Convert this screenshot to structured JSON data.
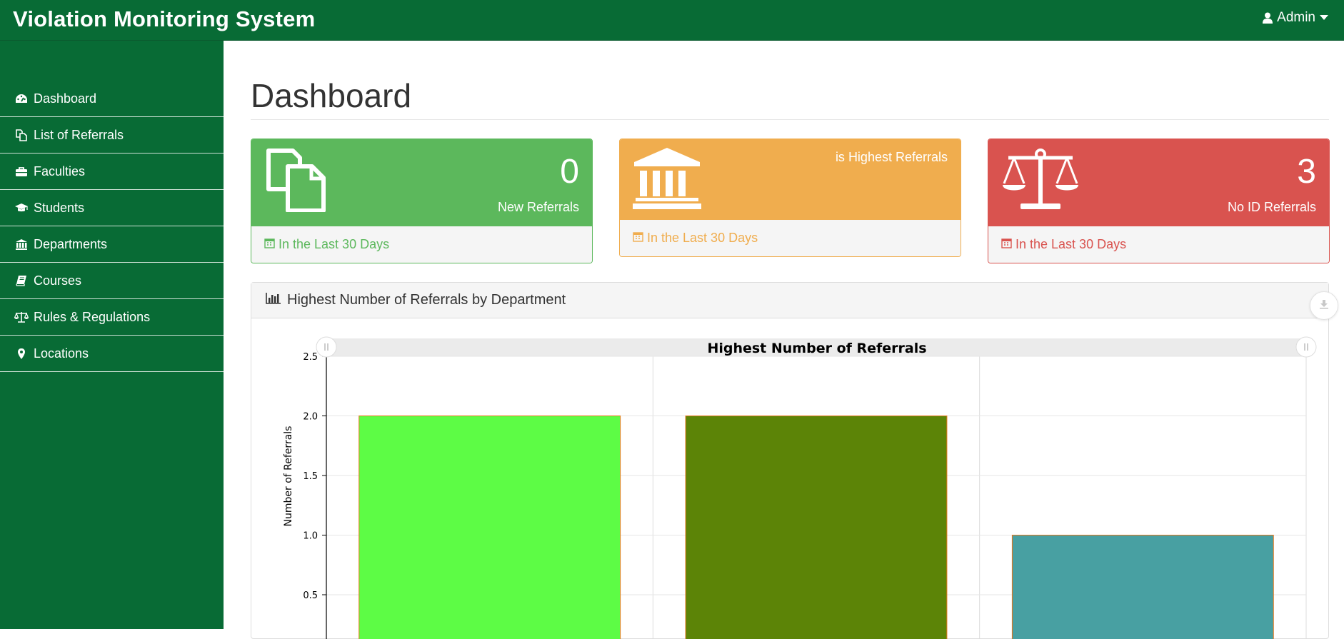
{
  "app": {
    "title": "Violation Monitoring System"
  },
  "user_menu": {
    "label": "Admin"
  },
  "sidebar": {
    "items": [
      {
        "label": "Dashboard",
        "icon": "dashboard-icon"
      },
      {
        "label": "List of Referrals",
        "icon": "copy-icon"
      },
      {
        "label": "Faculties",
        "icon": "briefcase-icon"
      },
      {
        "label": "Students",
        "icon": "graduation-cap-icon"
      },
      {
        "label": "Departments",
        "icon": "institution-icon"
      },
      {
        "label": "Courses",
        "icon": "book-icon"
      },
      {
        "label": "Rules & Regulations",
        "icon": "balance-scale-icon"
      },
      {
        "label": "Locations",
        "icon": "map-marker-icon"
      }
    ]
  },
  "page": {
    "title": "Dashboard"
  },
  "cards": [
    {
      "value": "0",
      "label": "New Referrals",
      "footer": "In the Last 30 Days",
      "color": "#5cb85c",
      "icon": "copy-icon"
    },
    {
      "value": "",
      "label": "is Highest Referrals",
      "footer": "In the Last 30 Days",
      "color": "#f0ad4e",
      "icon": "institution-icon"
    },
    {
      "value": "3",
      "label": "No ID Referrals",
      "footer": "In the Last 30 Days",
      "color": "#d9534f",
      "icon": "balance-scale-icon"
    }
  ],
  "panel": {
    "heading": "Highest Number of Referrals by Department"
  },
  "colors": {
    "brand_green": "#086b35"
  },
  "chart_data": {
    "type": "bar",
    "title": "Highest Number of Referrals",
    "xlabel": "",
    "ylabel": "Number of Referrals",
    "ylim": [
      0,
      2.5
    ],
    "yticks": [
      "0.5",
      "1.0",
      "1.5",
      "2.0",
      "2.5"
    ],
    "categories": [
      "",
      "",
      ""
    ],
    "values": [
      2,
      2,
      1
    ],
    "bar_colors": [
      "#5dfc45",
      "#5c8407",
      "#48a0a2"
    ],
    "bar_edge_color": "#e8761a",
    "grid": true
  }
}
